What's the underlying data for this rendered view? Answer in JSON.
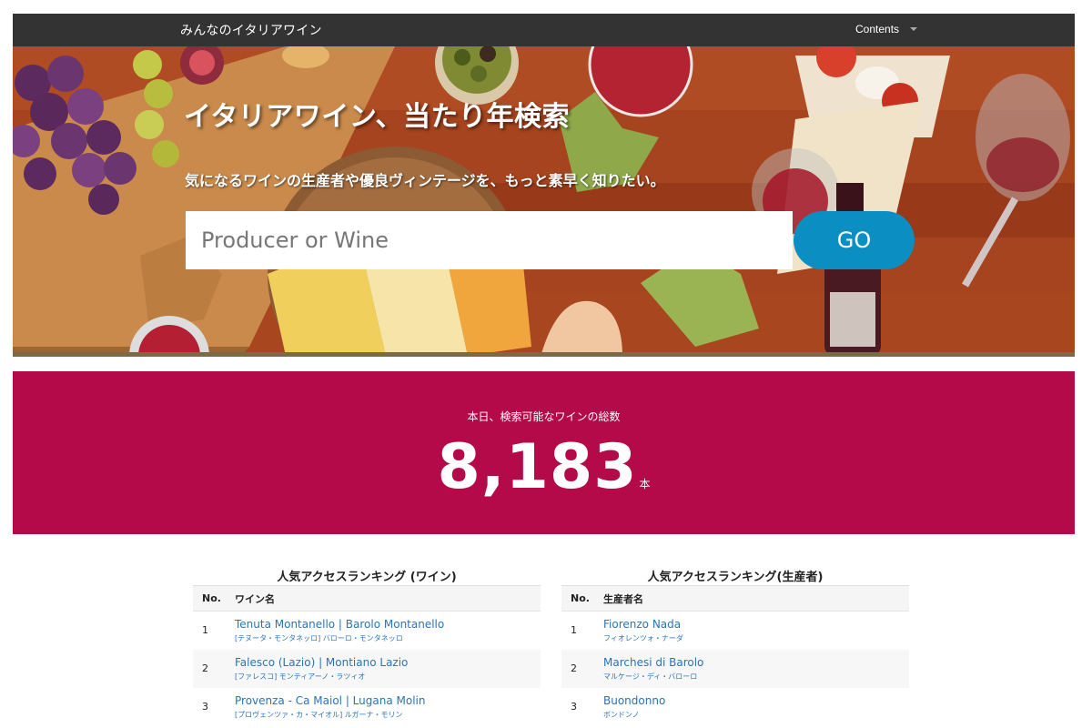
{
  "nav": {
    "brand": "みんなのイタリアワイン",
    "contents_label": "Contents"
  },
  "hero": {
    "title": "イタリアワイン、当たり年検索",
    "subtitle": "気になるワインの生産者や優良ヴィンテージを、もっと素早く知りたい。",
    "search_placeholder": "Producer or Wine",
    "search_value": "",
    "go_label": "GO"
  },
  "stats": {
    "label": "本日、検索可能なワインの総数",
    "count": "8,183",
    "unit": "本"
  },
  "wine_ranking": {
    "title": "人気アクセスランキング (ワイン)",
    "col_no": "No.",
    "col_name": "ワイン名",
    "rows": [
      {
        "no": "1",
        "name": "Tenuta Montanello | Barolo Montanello",
        "kana": "[テヌータ・モンタネッロ] バローロ・モンタネッロ"
      },
      {
        "no": "2",
        "name": "Falesco (Lazio) | Montiano Lazio",
        "kana": "[ファレスコ] モンティアーノ・ラツィオ"
      },
      {
        "no": "3",
        "name": "Provenza - Ca Maiol | Lugana Molin",
        "kana": "[プロヴェンツァ・カ・マイオル] ルガーナ・モリン"
      }
    ]
  },
  "producer_ranking": {
    "title": "人気アクセスランキング(生産者)",
    "col_no": "No.",
    "col_name": "生産者名",
    "rows": [
      {
        "no": "1",
        "name": "Fiorenzo Nada",
        "kana": "フィオレンツォ・ナーダ"
      },
      {
        "no": "2",
        "name": "Marchesi di Barolo",
        "kana": "マルケージ・ディ・バローロ"
      },
      {
        "no": "3",
        "name": "Buondonno",
        "kana": "ボンドンノ"
      }
    ]
  },
  "colors": {
    "navbar": "#333333",
    "stats_bg": "#b40a49",
    "go_button": "#0b8fc3",
    "link": "#2a73b8"
  }
}
